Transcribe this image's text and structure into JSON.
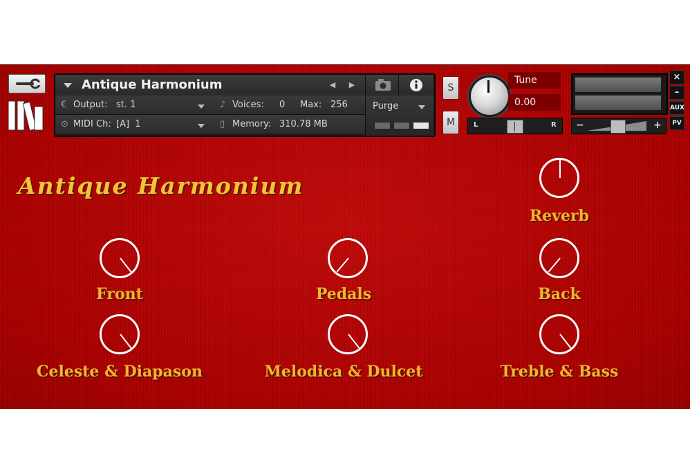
{
  "header": {
    "instrument_name": "Antique Harmonium",
    "output_label": "Output:",
    "output_value": "st. 1",
    "midi_label": "MIDI Ch:",
    "midi_value": "[A]  1",
    "voices_label": "Voices:",
    "voices_value": "0",
    "max_label": "Max:",
    "max_value": "256",
    "memory_label": "Memory:",
    "memory_value": "310.78 MB",
    "purge_label": "Purge",
    "solo_label": "S",
    "mute_label": "M",
    "tune_label": "Tune",
    "tune_value": "0.00",
    "pan_left": "L",
    "pan_right": "R",
    "vol_minus": "−",
    "vol_plus": "+",
    "close_label": "×",
    "minimize_label": "–",
    "aux_label": "AUX",
    "pv_label": "PV"
  },
  "main": {
    "title": "Antique Harmonium",
    "knobs": [
      {
        "label": "Reverb"
      },
      {
        "label": "Front"
      },
      {
        "label": "Pedals"
      },
      {
        "label": "Back"
      },
      {
        "label": "Celeste & Diapason"
      },
      {
        "label": "Melodica & Dulcet"
      },
      {
        "label": "Treble & Bass"
      }
    ]
  },
  "colors": {
    "background": "#b00000",
    "label_gold": "#f3b52e"
  }
}
